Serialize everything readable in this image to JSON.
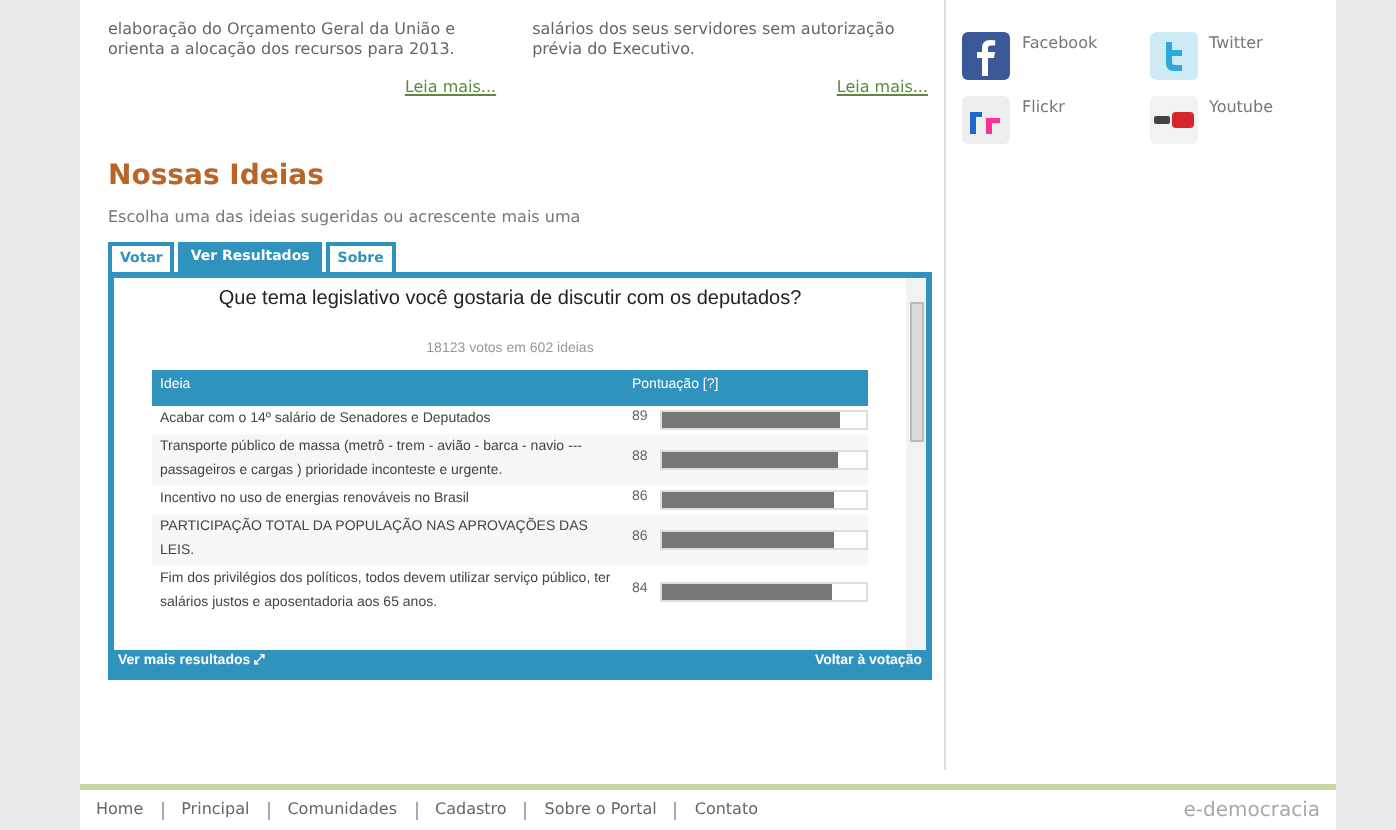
{
  "articles": [
    {
      "lines": [
        "elaboração do Orçamento Geral da União e",
        "orienta a alocação dos recursos para 2013."
      ],
      "link": "Leia mais..."
    },
    {
      "lines": [
        "salários dos seus servidores sem autorização",
        "prévia do Executivo."
      ],
      "link": "Leia mais..."
    }
  ],
  "ideas": {
    "title": "Nossas Ideias",
    "subtitle": "Escolha uma das ideias sugeridas ou acrescente mais uma",
    "tabs": [
      {
        "label": "Votar",
        "selected": false
      },
      {
        "label": "Ver Resultados",
        "selected": true
      },
      {
        "label": "Sobre",
        "selected": false
      }
    ],
    "question": "Que tema legislativo você gostaria de discutir com os deputados?",
    "summary": "18123 votos em 602 ideias",
    "table": {
      "columns": [
        "Ideia",
        "Pontuação [?]"
      ],
      "rows": [
        {
          "idea": "Acabar com o 14º salário de Senadores e Deputados",
          "score": "89",
          "level": 0.87
        },
        {
          "idea": "Transporte público de massa (metrô - trem - avião - barca - navio --- passageiros e cargas ) prioridade inconteste e urgente.",
          "score": "88",
          "level": 0.86
        },
        {
          "idea": "Incentivo no uso de energias renováveis no Brasil",
          "score": "86",
          "level": 0.84
        },
        {
          "idea": "PARTICIPAÇÃO TOTAL DA POPULAÇÃO NAS APROVAÇÕES DAS LEIS.",
          "score": "86",
          "level": 0.84
        },
        {
          "idea": "Fim dos privilégios dos políticos, todos devem utilizar serviço público, ter salários justos e aposentadoria aos 65 anos.",
          "score": "84",
          "level": 0.83
        }
      ]
    },
    "more_link": "Ver mais resultados ⤢",
    "back_link": "Voltar à votação"
  },
  "social": [
    {
      "kind": "facebook",
      "label": "Facebook"
    },
    {
      "kind": "twitter",
      "label": "Twitter"
    },
    {
      "kind": "flickr",
      "label": "Flickr"
    },
    {
      "kind": "youtube",
      "label": "Youtube"
    }
  ],
  "footer": {
    "links": [
      "Home",
      "Principal",
      "Comunidades",
      "Cadastro",
      "Sobre o Portal",
      "Contato"
    ],
    "brand": "e-democracia"
  }
}
